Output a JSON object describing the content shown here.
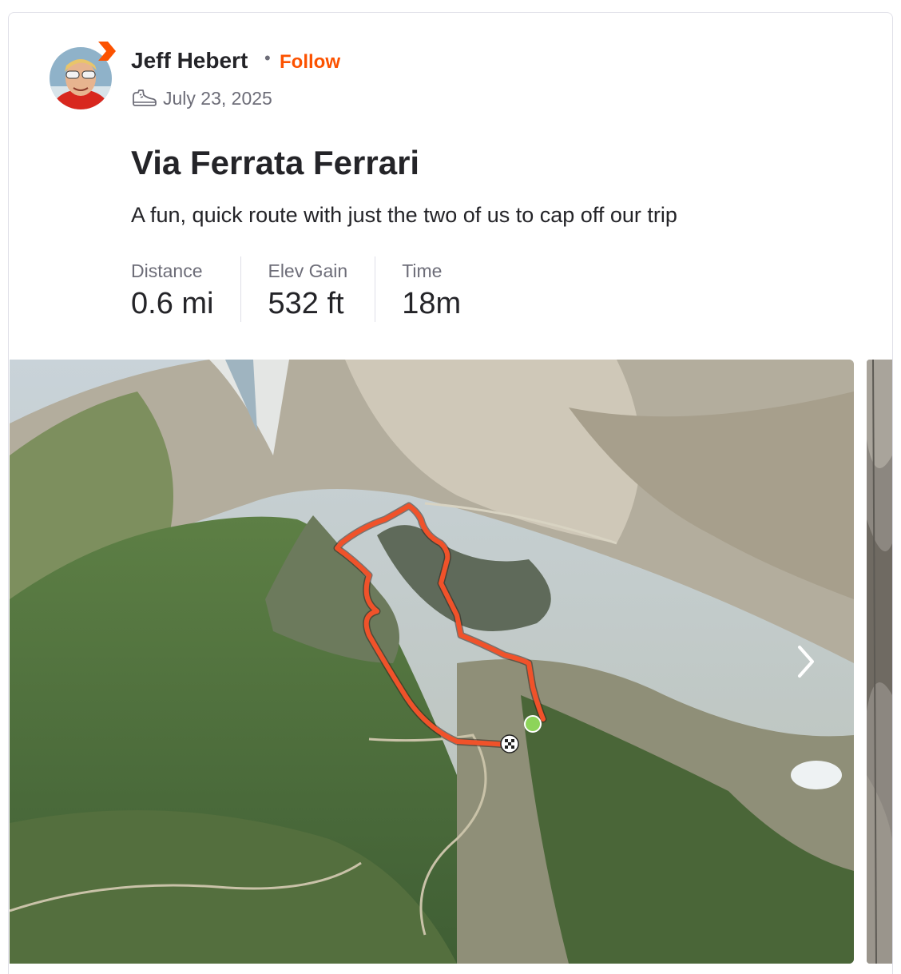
{
  "activity": {
    "athlete_name": "Jeff Hebert",
    "follow_label": "Follow",
    "separator": "•",
    "date": "July 23, 2025",
    "sport_icon": "hike-shoe-icon",
    "title": "Via Ferrata Ferrari",
    "description": "A fun, quick route with just the two of us to cap off our trip",
    "stats": [
      {
        "label": "Distance",
        "value": "0.6 mi"
      },
      {
        "label": "Elev Gain",
        "value": "532 ft"
      },
      {
        "label": "Time",
        "value": "18m"
      }
    ]
  },
  "colors": {
    "brand": "#fc5200",
    "route": "#f0522a",
    "start_marker": "#8dd45a"
  },
  "map": {
    "carousel_next_icon": "chevron-right-icon",
    "start_marker_icon": "green-dot-icon",
    "finish_marker_icon": "checkered-flag-icon"
  }
}
